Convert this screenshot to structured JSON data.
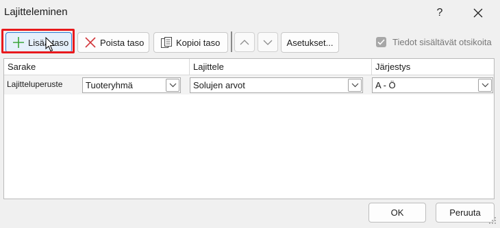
{
  "window": {
    "title": "Lajitteleminen",
    "help_label": "?"
  },
  "toolbar": {
    "add_level": "Lisää taso",
    "delete_level": "Poista taso",
    "copy_level": "Kopioi taso",
    "options": "Asetukset...",
    "headers_checkbox_label": "Tiedot sisältävät otsikoita",
    "headers_checked": true
  },
  "grid": {
    "columns": [
      "Sarake",
      "Lajittele",
      "Järjestys"
    ],
    "rows": [
      {
        "label": "Lajitteluperuste",
        "column": "Tuoteryhmä",
        "sort_on": "Solujen arvot",
        "order": "A - Ö"
      }
    ]
  },
  "footer": {
    "ok": "OK",
    "cancel": "Peruuta"
  },
  "colors": {
    "highlight": "#e8191c",
    "add_icon": "#3aa53a",
    "delete_icon": "#d13438"
  }
}
